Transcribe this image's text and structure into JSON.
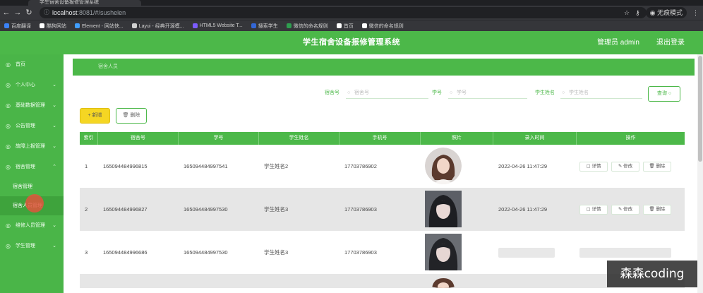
{
  "browser": {
    "tab_title": "学生宿舍设备报修管理系统",
    "url_host": "localhost",
    "url_rest": ":8081/#/sushelen",
    "incognito_label": "无痕模式",
    "bookmarks": [
      {
        "label": "百度翻译",
        "color": "#3b82f6"
      },
      {
        "label": "酷狗网站",
        "color": "#ffffff"
      },
      {
        "label": "Element - 网站快...",
        "color": "#409eff"
      },
      {
        "label": "Layui - 经典开源模...",
        "color": "#d0d0d0"
      },
      {
        "label": "HTML5 Website T...",
        "color": "#7c5cff"
      },
      {
        "label": "搜索学生",
        "color": "#3367d6"
      },
      {
        "label": "微信的命名规则",
        "color": "#2e9e4f"
      },
      {
        "label": "首页",
        "color": "#ffffff"
      },
      {
        "label": "微信的命名规则",
        "color": "#ffffff"
      }
    ]
  },
  "header": {
    "title": "学生宿舍设备报修管理系统",
    "admin_label": "管理员 admin",
    "logout_label": "退出登录"
  },
  "sidebar": {
    "items": [
      {
        "label": "首页"
      },
      {
        "label": "个人中心"
      },
      {
        "label": "基础数据管理"
      },
      {
        "label": "公告管理"
      },
      {
        "label": "故障上报管理"
      },
      {
        "label": "宿舍管理"
      }
    ],
    "subitems": [
      {
        "label": "宿舍管理"
      },
      {
        "label": "宿舍人员管理"
      }
    ],
    "items_after": [
      {
        "label": "维修人员管理"
      },
      {
        "label": "学生管理"
      }
    ]
  },
  "breadcrumb": {
    "label": "宿舍人员"
  },
  "search": {
    "dorm_label": "宿舍号",
    "dorm_placeholder": "宿舍号",
    "student_no_label": "学号",
    "student_no_placeholder": "学号",
    "student_name_label": "学生姓名",
    "student_name_placeholder": "学生姓名",
    "query_label": "查询"
  },
  "actions": {
    "add_label": "+ 新增",
    "delete_label": "删除"
  },
  "table": {
    "headers": [
      "索引",
      "宿舍号",
      "学号",
      "学生姓名",
      "手机号",
      "照片",
      "录入时间",
      "操作"
    ],
    "rows": [
      {
        "index": "1",
        "dorm": "165094484996815",
        "student_no": "165094484997541",
        "name": "学生姓名2",
        "phone": "17703786902",
        "time": "2022-04-26 11:47:29"
      },
      {
        "index": "2",
        "dorm": "165094484996827",
        "student_no": "165094484997530",
        "name": "学生姓名3",
        "phone": "17703786903",
        "time": "2022-04-26 11:47:29"
      },
      {
        "index": "3",
        "dorm": "165094484996686",
        "student_no": "165094484997530",
        "name": "学生姓名3",
        "phone": "17703786903",
        "time": ""
      }
    ],
    "op_labels": {
      "detail": "详情",
      "edit": "修改",
      "delete": "删除"
    }
  },
  "watermark": "森森coding"
}
